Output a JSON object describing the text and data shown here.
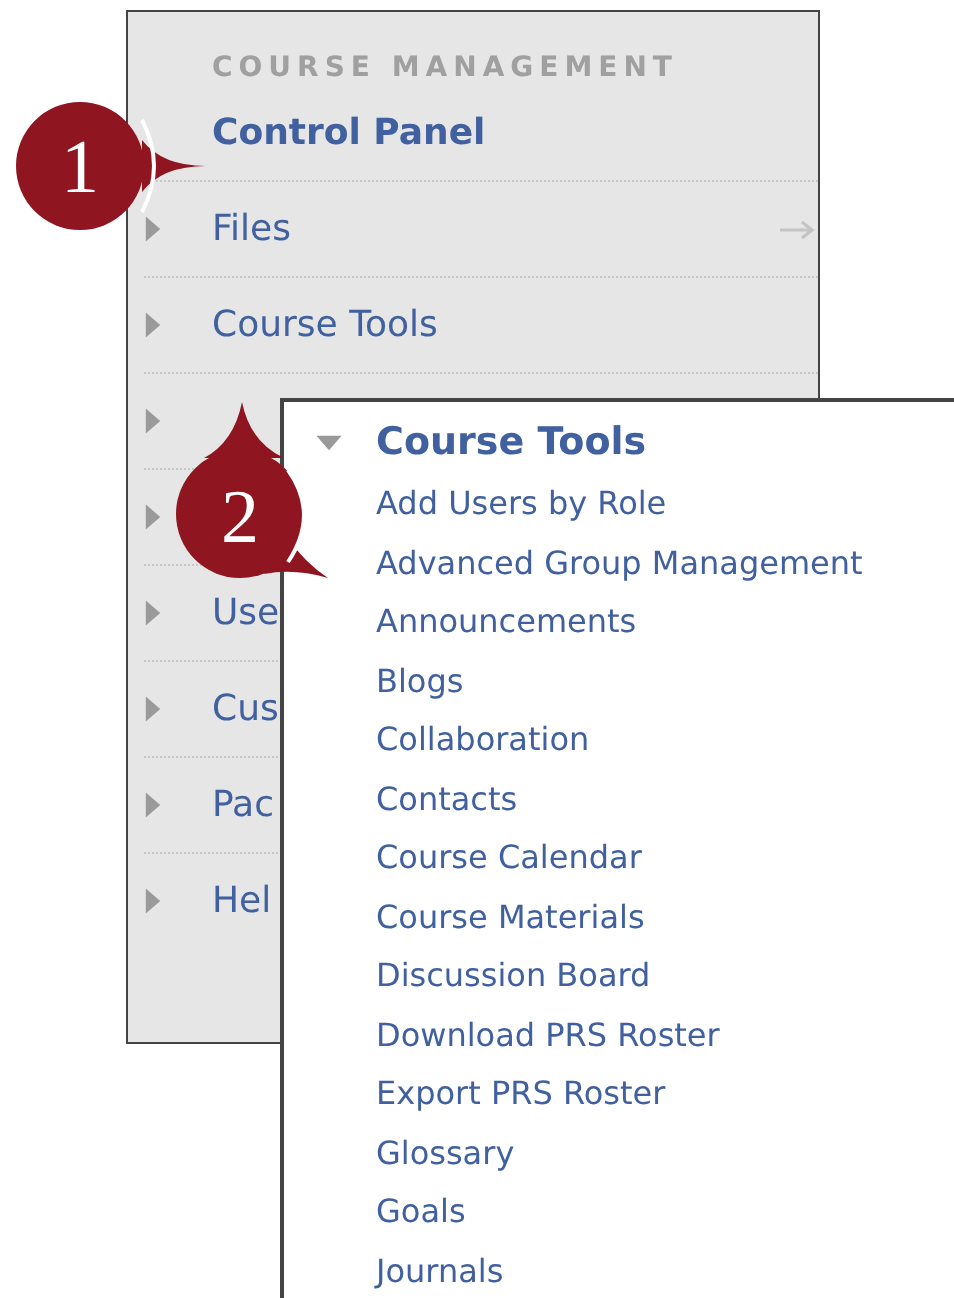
{
  "sidebar": {
    "heading": "COURSE MANAGEMENT",
    "items": [
      {
        "kind": "current",
        "label": "Control Panel"
      },
      {
        "kind": "link",
        "label": "Files"
      },
      {
        "kind": "menu",
        "label": "Course Tools"
      },
      {
        "kind": "menu"
      },
      {
        "kind": "menu"
      },
      {
        "kind": "menu",
        "label": "Use"
      },
      {
        "kind": "menu",
        "label": "Cus"
      },
      {
        "kind": "menu",
        "label": "Pac"
      },
      {
        "kind": "menu",
        "label": "Hel"
      }
    ]
  },
  "popup": {
    "title": "Course Tools",
    "expanded": true,
    "items": [
      "Add Users by Role",
      "Advanced Group Management",
      "Announcements",
      "Blogs",
      "Collaboration",
      "Contacts",
      "Course Calendar",
      "Course Materials",
      "Discussion Board",
      "Download PRS Roster",
      "Export PRS Roster",
      "Glossary",
      "Goals",
      "Journals"
    ]
  },
  "callouts": [
    {
      "number": "1"
    },
    {
      "number": "2"
    }
  ]
}
